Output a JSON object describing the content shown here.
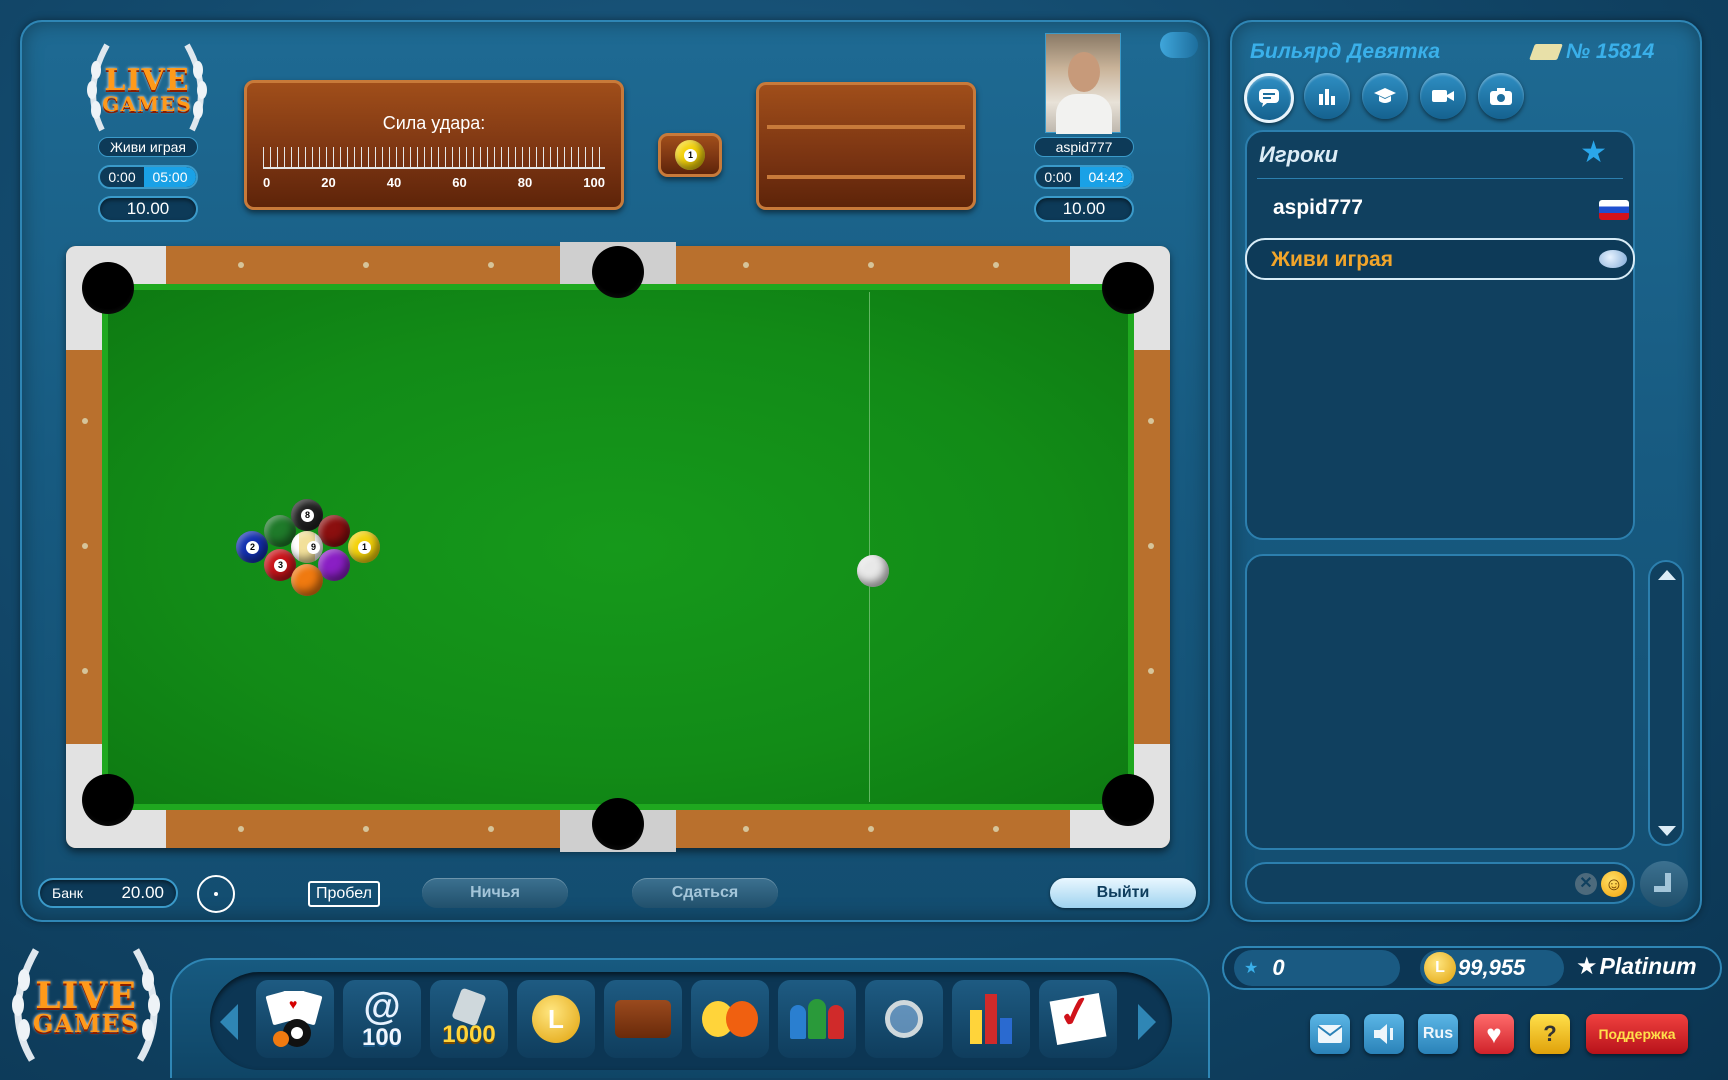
{
  "player_left": {
    "name": "Живи играя",
    "time_used": "0:00",
    "time_left": "05:00",
    "bet": "10.00"
  },
  "player_right": {
    "name": "aspid777",
    "time_used": "0:00",
    "time_left": "04:42",
    "bet": "10.00"
  },
  "logo": {
    "line1": "LIVE",
    "line2": "GAMES"
  },
  "power": {
    "label": "Сила удара:",
    "ticks": [
      "0",
      "20",
      "40",
      "60",
      "80",
      "100"
    ]
  },
  "target_ball": "1",
  "rack": [
    {
      "num": "8",
      "color": "#222222"
    },
    {
      "num": "",
      "color": "#1f7a2a"
    },
    {
      "num": "",
      "color": "#8b0f0f"
    },
    {
      "num": "2",
      "color": "#1330b0"
    },
    {
      "num": "9",
      "color": "#f2e9b0"
    },
    {
      "num": "1",
      "color": "#f4d20a"
    },
    {
      "num": "3",
      "color": "#c9141a"
    },
    {
      "num": "",
      "color": "#8a1fc4"
    },
    {
      "num": "",
      "color": "#f07a10"
    }
  ],
  "bottom_bar": {
    "bank_label": "Банк",
    "bank_value": "20.00",
    "space": "Пробел",
    "draw": "Ничья",
    "surrender": "Сдаться",
    "exit": "Выйти"
  },
  "side": {
    "game_title": "Бильярд Девятка",
    "table_no": "№ 15814",
    "players_header": "Игроки",
    "players": [
      {
        "name": "aspid777",
        "flag": "ru"
      },
      {
        "name": "Живи играя",
        "flag": "globe"
      }
    ]
  },
  "status": {
    "stars": "0",
    "coins": "99,955",
    "level": "Platinum"
  },
  "toolbar_items": [
    {
      "icon": "cards-icon",
      "label": ""
    },
    {
      "icon": "at-100-icon",
      "label": "100"
    },
    {
      "icon": "phone-1000-icon",
      "label": "1000"
    },
    {
      "icon": "coin-clock-icon",
      "label": ""
    },
    {
      "icon": "wallet-icon",
      "label": ""
    },
    {
      "icon": "masks-icon",
      "label": ""
    },
    {
      "icon": "people-icon",
      "label": ""
    },
    {
      "icon": "search-person-icon",
      "label": ""
    },
    {
      "icon": "bar-chart-icon",
      "label": ""
    },
    {
      "icon": "checkmark-icon",
      "label": ""
    }
  ],
  "small_buttons": {
    "lang": "Rus",
    "support": "Поддержка"
  },
  "colors": {
    "felt": "#128b17",
    "rail": "#b9702d",
    "accent": "#1aa1e6"
  }
}
